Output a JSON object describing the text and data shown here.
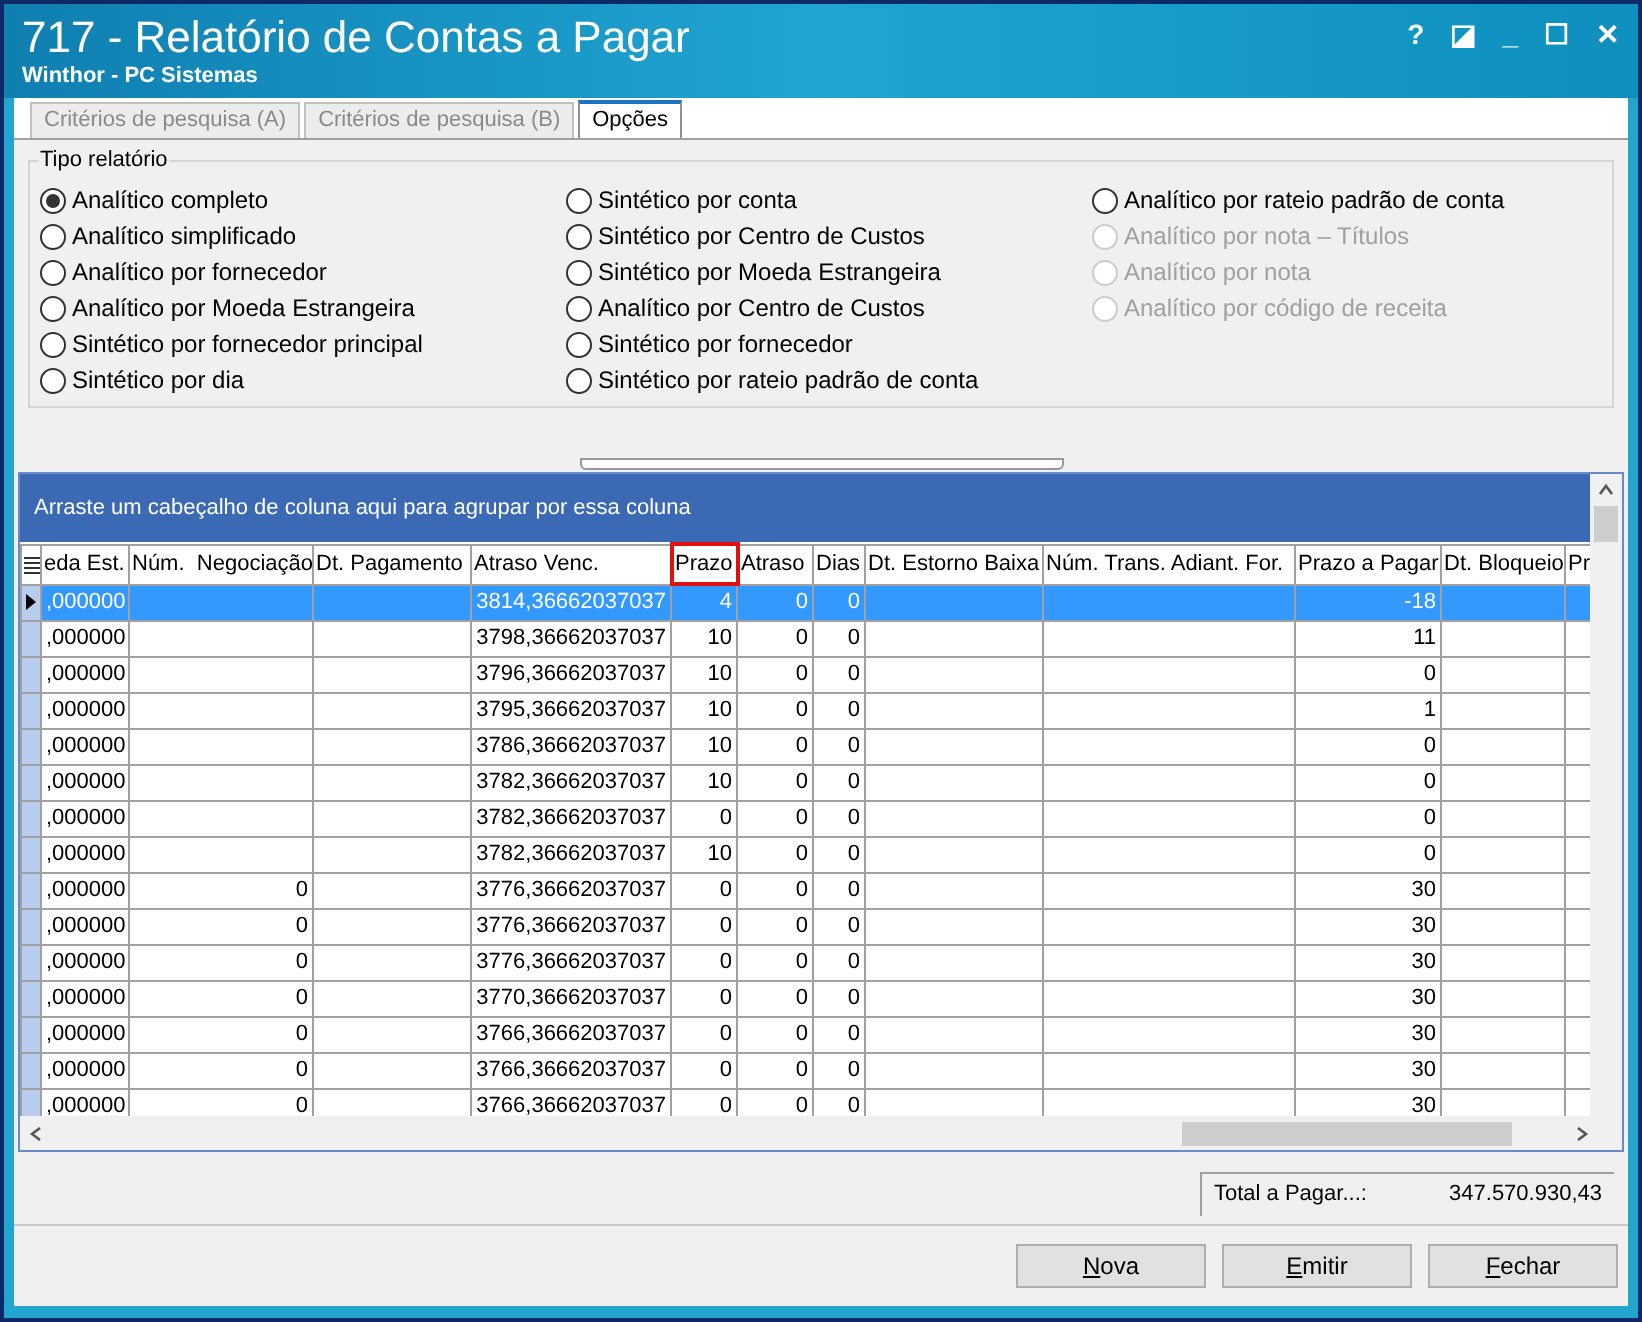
{
  "window": {
    "title": "717 - Relatório de Contas a Pagar",
    "subtitle": "Winthor - PC Sistemas",
    "controls": [
      "?",
      "◪",
      "_",
      "☐",
      "✕"
    ]
  },
  "tabs": [
    {
      "label": "Critérios de pesquisa (A)",
      "selected": false
    },
    {
      "label": "Critérios de pesquisa (B)",
      "selected": false
    },
    {
      "label": "Opções",
      "selected": true
    }
  ],
  "report_type": {
    "title": "Tipo relatório",
    "columns": [
      [
        {
          "label": "Analítico completo",
          "selected": true,
          "disabled": false
        },
        {
          "label": "Analítico simplificado",
          "selected": false,
          "disabled": false
        },
        {
          "label": "Analítico por fornecedor",
          "selected": false,
          "disabled": false
        },
        {
          "label": "Analítico por Moeda Estrangeira",
          "selected": false,
          "disabled": false
        },
        {
          "label": "Sintético por fornecedor principal",
          "selected": false,
          "disabled": false
        },
        {
          "label": "Sintético por dia",
          "selected": false,
          "disabled": false
        }
      ],
      [
        {
          "label": "Sintético por conta",
          "selected": false,
          "disabled": false
        },
        {
          "label": "Sintético por Centro de Custos",
          "selected": false,
          "disabled": false
        },
        {
          "label": "Sintético por Moeda Estrangeira",
          "selected": false,
          "disabled": false
        },
        {
          "label": "Analítico por Centro de Custos",
          "selected": false,
          "disabled": false
        },
        {
          "label": "Sintético por fornecedor",
          "selected": false,
          "disabled": false
        },
        {
          "label": "Sintético por rateio padrão de conta",
          "selected": false,
          "disabled": false
        }
      ],
      [
        {
          "label": "Analítico por rateio padrão de conta",
          "selected": false,
          "disabled": false
        },
        {
          "label": "Analítico por nota – Títulos",
          "selected": false,
          "disabled": true
        },
        {
          "label": "Analítico por nota",
          "selected": false,
          "disabled": true
        },
        {
          "label": "Analítico por código de receita",
          "selected": false,
          "disabled": true
        }
      ]
    ]
  },
  "grid": {
    "group_hint": "Arraste um cabeçalho de coluna aqui para agrupar por essa coluna",
    "columns": [
      {
        "label": "eda Est.",
        "highlighted": false
      },
      {
        "label": "Núm.  Negociação",
        "highlighted": false
      },
      {
        "label": "Dt. Pagamento",
        "highlighted": false
      },
      {
        "label": "Atraso Venc.",
        "highlighted": false
      },
      {
        "label": "Prazo",
        "highlighted": true
      },
      {
        "label": "Atraso",
        "highlighted": false
      },
      {
        "label": "Dias",
        "highlighted": false
      },
      {
        "label": "Dt. Estorno Baixa",
        "highlighted": false
      },
      {
        "label": "Núm. Trans. Adiant. For.",
        "highlighted": false
      },
      {
        "label": "Prazo a Pagar",
        "highlighted": false
      },
      {
        "label": "Dt. Bloqueio",
        "highlighted": false
      },
      {
        "label": "Pr",
        "highlighted": false
      }
    ],
    "rows": [
      {
        "selected": true,
        "cells": [
          ",000000",
          "",
          "",
          "3814,36662037037",
          "4",
          "0",
          "0",
          "",
          "",
          "-18",
          "",
          ""
        ]
      },
      {
        "selected": false,
        "cells": [
          ",000000",
          "",
          "",
          "3798,36662037037",
          "10",
          "0",
          "0",
          "",
          "",
          "11",
          "",
          ""
        ]
      },
      {
        "selected": false,
        "cells": [
          ",000000",
          "",
          "",
          "3796,36662037037",
          "10",
          "0",
          "0",
          "",
          "",
          "0",
          "",
          ""
        ]
      },
      {
        "selected": false,
        "cells": [
          ",000000",
          "",
          "",
          "3795,36662037037",
          "10",
          "0",
          "0",
          "",
          "",
          "1",
          "",
          ""
        ]
      },
      {
        "selected": false,
        "cells": [
          ",000000",
          "",
          "",
          "3786,36662037037",
          "10",
          "0",
          "0",
          "",
          "",
          "0",
          "",
          ""
        ]
      },
      {
        "selected": false,
        "cells": [
          ",000000",
          "",
          "",
          "3782,36662037037",
          "10",
          "0",
          "0",
          "",
          "",
          "0",
          "",
          ""
        ]
      },
      {
        "selected": false,
        "cells": [
          ",000000",
          "",
          "",
          "3782,36662037037",
          "0",
          "0",
          "0",
          "",
          "",
          "0",
          "",
          ""
        ]
      },
      {
        "selected": false,
        "cells": [
          ",000000",
          "",
          "",
          "3782,36662037037",
          "10",
          "0",
          "0",
          "",
          "",
          "0",
          "",
          ""
        ]
      },
      {
        "selected": false,
        "cells": [
          ",000000",
          "0",
          "",
          "3776,36662037037",
          "0",
          "0",
          "0",
          "",
          "",
          "30",
          "",
          ""
        ]
      },
      {
        "selected": false,
        "cells": [
          ",000000",
          "0",
          "",
          "3776,36662037037",
          "0",
          "0",
          "0",
          "",
          "",
          "30",
          "",
          ""
        ]
      },
      {
        "selected": false,
        "cells": [
          ",000000",
          "0",
          "",
          "3776,36662037037",
          "0",
          "0",
          "0",
          "",
          "",
          "30",
          "",
          ""
        ]
      },
      {
        "selected": false,
        "cells": [
          ",000000",
          "0",
          "",
          "3770,36662037037",
          "0",
          "0",
          "0",
          "",
          "",
          "30",
          "",
          ""
        ]
      },
      {
        "selected": false,
        "cells": [
          ",000000",
          "0",
          "",
          "3766,36662037037",
          "0",
          "0",
          "0",
          "",
          "",
          "30",
          "",
          ""
        ]
      },
      {
        "selected": false,
        "cells": [
          ",000000",
          "0",
          "",
          "3766,36662037037",
          "0",
          "0",
          "0",
          "",
          "",
          "30",
          "",
          ""
        ]
      },
      {
        "selected": false,
        "cells": [
          ",000000",
          "0",
          "",
          "3766,36662037037",
          "0",
          "0",
          "0",
          "",
          "",
          "30",
          "",
          ""
        ]
      }
    ]
  },
  "total": {
    "label": "Total a Pagar...:",
    "value": "347.570.930,43"
  },
  "buttons": [
    "Nova",
    "Emitir",
    "Fechar"
  ]
}
